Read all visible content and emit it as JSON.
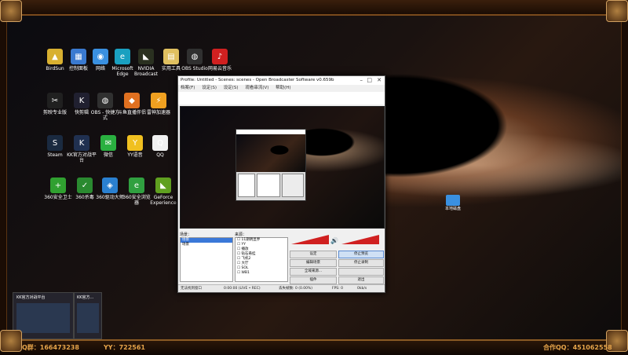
{
  "frame": {
    "qq_group": "Q群：166473238",
    "yy": "YY：722561",
    "coop_qq": "合作QQ：451062558"
  },
  "desktop_icons": [
    {
      "label": "BirdSun",
      "color": "#d8b030",
      "glyph": "▲",
      "icon": "birdsun-icon"
    },
    {
      "label": "控制面板",
      "color": "#3a7ad0",
      "glyph": "▦",
      "icon": "control-panel-icon"
    },
    {
      "label": "网络",
      "color": "#3a90e0",
      "glyph": "◉",
      "icon": "network-icon"
    },
    {
      "label": "Microsoft Edge",
      "color": "#1aa0c0",
      "glyph": "e",
      "icon": "edge-icon"
    },
    {
      "label": "NVIDIA Broadcast",
      "color": "#2a3020",
      "glyph": "◣",
      "icon": "nvidia-broadcast-icon"
    },
    {
      "label": "实用工具",
      "color": "#e0c060",
      "glyph": "▤",
      "icon": "folder-icon"
    },
    {
      "label": "OBS Studio",
      "color": "#303030",
      "glyph": "◍",
      "icon": "obs-icon"
    },
    {
      "label": "网易云音乐",
      "color": "#d02020",
      "glyph": "♪",
      "icon": "netease-music-icon"
    },
    {
      "label": "剪映专业版",
      "color": "#202020",
      "glyph": "✂",
      "icon": "jianying-icon"
    },
    {
      "label": "快剪辑",
      "color": "#202030",
      "glyph": "K",
      "icon": "kuaijianji-icon"
    },
    {
      "label": "OBS - 快捷方式",
      "color": "#303030",
      "glyph": "◍",
      "icon": "obs-shortcut-icon"
    },
    {
      "label": "斗鱼直播伴侣",
      "color": "#e07020",
      "glyph": "◆",
      "icon": "douyu-icon"
    },
    {
      "label": "雷神加速器",
      "color": "#f0a020",
      "glyph": "⚡",
      "icon": "leishen-icon"
    },
    {
      "label": "Steam",
      "color": "#1a2a40",
      "glyph": "S",
      "icon": "steam-icon"
    },
    {
      "label": "KK官方对战平台",
      "color": "#203050",
      "glyph": "K",
      "icon": "kk-platform-icon"
    },
    {
      "label": "微信",
      "color": "#2ab040",
      "glyph": "✉",
      "icon": "wechat-icon"
    },
    {
      "label": "YY语音",
      "color": "#f0c020",
      "glyph": "Y",
      "icon": "yy-icon"
    },
    {
      "label": "QQ",
      "color": "#f0f0f0",
      "glyph": "Q",
      "icon": "qq-icon"
    },
    {
      "label": "360安全卫士",
      "color": "#30a030",
      "glyph": "+",
      "icon": "360-safe-icon"
    },
    {
      "label": "360杀毒",
      "color": "#2a8a30",
      "glyph": "✓",
      "icon": "360-antivirus-icon"
    },
    {
      "label": "360驱动大师",
      "color": "#2a80d0",
      "glyph": "◈",
      "icon": "360-driver-icon"
    },
    {
      "label": "360安全浏览器",
      "color": "#30a040",
      "glyph": "e",
      "icon": "360-browser-icon"
    },
    {
      "label": "GeForce Experience",
      "color": "#60a020",
      "glyph": "◣",
      "icon": "geforce-icon"
    }
  ],
  "disk_label": "本地磁盘",
  "obs": {
    "title": "Profile: Untitled - Scenes: scenes - Open Broadcaster Software v0.659b",
    "menu": [
      "档案(F)",
      "设定(S)",
      "设定(S)",
      "观看串流(V)",
      "帮助(H)"
    ],
    "scenes_label": "场景：",
    "sources_label": "来源：",
    "scenes": [
      "场景",
      "场景"
    ],
    "sources": [
      "11期明显界",
      "YY",
      "播放",
      "钻石悬挂",
      "飞机2",
      "大厅",
      "SOL",
      "WB1"
    ],
    "buttons": {
      "settings": "设定",
      "stop_preview": "停止预览",
      "edit_scene": "编辑场景",
      "stop_record": "停止录制",
      "global_source": "全域来源...",
      "plugins": "插件",
      "exit": "退出"
    },
    "status": {
      "text": "无法找到窗口",
      "time": "0:00:00 (LIVE • REC)",
      "dropped": "丢失帧数: 0 (0.00%)",
      "fps": "FPS: 0",
      "kbps": "0kb/s"
    }
  },
  "taskbar_thumbs": [
    {
      "title": "KK官方对战平台"
    },
    {
      "title": "KK官方..."
    }
  ]
}
